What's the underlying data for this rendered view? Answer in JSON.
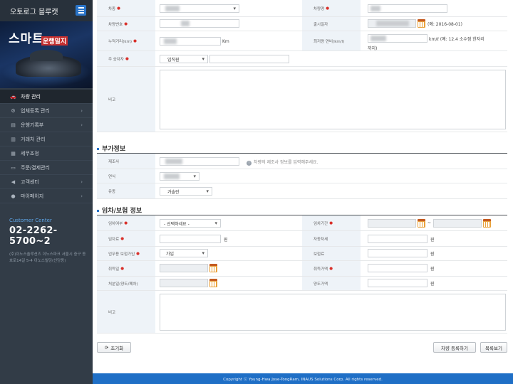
{
  "sidebar": {
    "brand": "오토로그 블루캣",
    "banner_title": "스마트",
    "banner_sub": "운행일지",
    "items": [
      {
        "label": "차량 관리",
        "icon": "car-icon"
      },
      {
        "label": "업체등록 관리",
        "icon": "gear-icon"
      },
      {
        "label": "운행기록부",
        "icon": "truck-icon"
      },
      {
        "label": "거래처 관리",
        "icon": "building-icon"
      },
      {
        "label": "세무조정",
        "icon": "calculator-icon"
      },
      {
        "label": "주문/결제관리",
        "icon": "card-icon"
      },
      {
        "label": "고객센터",
        "icon": "speaker-icon"
      },
      {
        "label": "마이페이지",
        "icon": "user-icon"
      }
    ],
    "customer_center_label": "Customer Center",
    "customer_center_phone": "02-2262-5700~2",
    "address": "(주)이노스솔루션즈 이노스파크 서울시 중구 동호로14길 5-4 이노스빌딩(신당동)"
  },
  "form": {
    "vehicle_type_label": "차종",
    "vehicle_name_label": "차량명",
    "plate_label": "차량번호",
    "purchase_date_label": "출시일자",
    "purchase_date_hint": "(예: 2016-08-01)",
    "mileage_label": "누적거리(km)",
    "mileage_unit": "Km",
    "efficiency_label": "최저량 연비(km/l)",
    "efficiency_hint": "km/ℓ (예: 12.4 소수점 한자리",
    "efficiency_hint2": "까지)",
    "driver_label": "주 승차자",
    "driver_value": "임직원",
    "memo_label": "비고"
  },
  "extra": {
    "title": "부가정보",
    "maker_label": "제조사",
    "maker_hint": "차량의 제조사 정보를 입력해주세요.",
    "color_label": "연식",
    "fuel_label": "유종",
    "fuel_value": "가솔린"
  },
  "lease": {
    "title": "임차/보험 정보",
    "lease_type_label": "임차여부",
    "lease_type_value": "- 선택하세요 -",
    "lease_period_label": "임차기간",
    "lease_period_sep": "~",
    "deposit_label": "임차료",
    "deposit_unit": "원",
    "self_pay_label": "자동차세",
    "self_pay_unit": "원",
    "insurance_label": "업무용 보험가입",
    "insurance_value": "가입",
    "insurance_fee_label": "보험료",
    "insurance_fee_unit": "원",
    "acquire_label": "취득일",
    "acquire_price_label": "취득가액",
    "acquire_price_unit": "원",
    "dispose_date_label": "처분일(양도/폐차)",
    "dispose_price_label": "양도가액",
    "dispose_price_unit": "원",
    "memo_label": "비고"
  },
  "buttons": {
    "reset": "초기화",
    "register": "차량 등록하기",
    "list": "목록보기"
  },
  "footer": "Copyright ⓒ Young-Hwa Jose-TongRam, INAUS Solutions Corp. All rights reserved."
}
